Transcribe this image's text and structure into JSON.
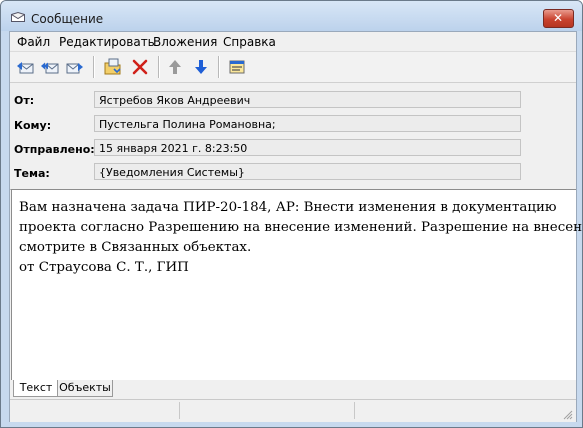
{
  "window": {
    "title": "Сообщение"
  },
  "menu": [
    "Файл",
    "Редактировать",
    "Вложения",
    "Справка"
  ],
  "toolbar": {
    "buttons": [
      "reply-icon",
      "reply-all-icon",
      "forward-icon",
      "move-to-folder-icon",
      "delete-icon",
      "previous-up-icon",
      "next-down-icon",
      "properties-icon"
    ]
  },
  "header": {
    "from_label": "От:",
    "from_value": "Ястребов Яков Андреевич",
    "to_label": "Кому:",
    "to_value": "Пустельга Полина Романовна;",
    "sent_label": "Отправлено:",
    "sent_value": "15 января 2021 г. 8:23:50",
    "subject_label": "Тема:",
    "subject_value": "{Уведомления Системы}"
  },
  "message": {
    "lines": [
      "Вам назначена задача ПИР-20-184, АР: Внести изменения в документацию",
      "проекта согласно Разрешению на внесение изменений. Разрешение на внесение",
      "смотрите в Связанных объектах.",
      "от Страусова С. Т., ГИП"
    ]
  },
  "tabs": [
    "Текст",
    "Объекты"
  ],
  "colors": {
    "close": "#c9432f",
    "titlebar": "#c7d9ee",
    "delete": "#d0211a",
    "arrow_down": "#1f5fd6"
  }
}
